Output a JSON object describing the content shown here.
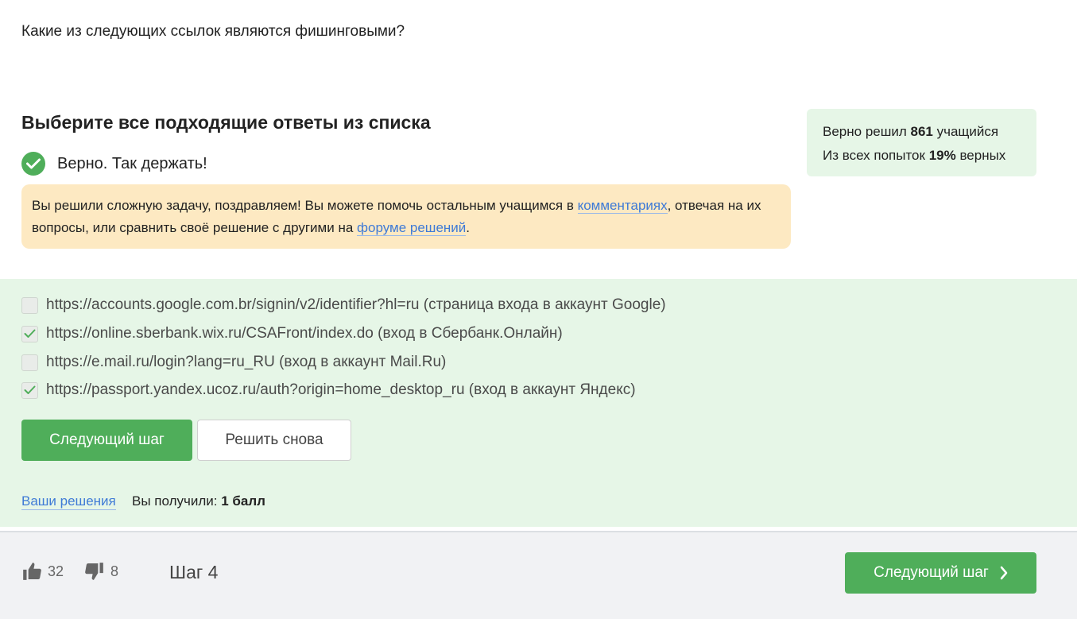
{
  "question": "Какие из следующих ссылок являются фишинговыми?",
  "instruction": "Выберите все подходящие ответы из списка",
  "result": {
    "text": "Верно. Так держать!"
  },
  "congrats": {
    "text_before_link1": "Вы решили сложную задачу, поздравляем! Вы можете помочь остальным учащимся в ",
    "link1": "комментариях",
    "text_between": ", отвечая на их вопросы, или сравнить своё решение с другими на ",
    "link2": "форуме решений",
    "text_after": "."
  },
  "stats": {
    "line1_prefix": "Верно решил ",
    "solved_count": "861",
    "line1_suffix": " учащийся",
    "line2_prefix": "Из всех попыток ",
    "percent": "19%",
    "line2_suffix": " верных"
  },
  "options": [
    {
      "label": "https://accounts.google.com.br/signin/v2/identifier?hl=ru (страница входа в аккаунт Google)",
      "checked": false
    },
    {
      "label": "https://online.sberbank.wix.ru/CSAFront/index.do (вход в Сбербанк.Онлайн)",
      "checked": true
    },
    {
      "label": "https://e.mail.ru/login?lang=ru_RU (вход в аккаунт Mail.Ru)",
      "checked": false
    },
    {
      "label": "https://passport.yandex.ucoz.ru/auth?origin=home_desktop_ru (вход в аккаунт Яндекс)",
      "checked": true
    }
  ],
  "buttons": {
    "next": "Следующий шаг",
    "retry": "Решить снова"
  },
  "solutions_link": "Ваши решения",
  "score": {
    "prefix": "Вы получили: ",
    "value": "1 балл"
  },
  "footer": {
    "likes": "32",
    "dislikes": "8",
    "step": "Шаг 4",
    "next": "Следующий шаг"
  },
  "colors": {
    "accent_green": "#4fae5a",
    "success_bg": "#e6f6e7",
    "warning_bg": "#fde9c2",
    "link": "#3e7ad6"
  }
}
